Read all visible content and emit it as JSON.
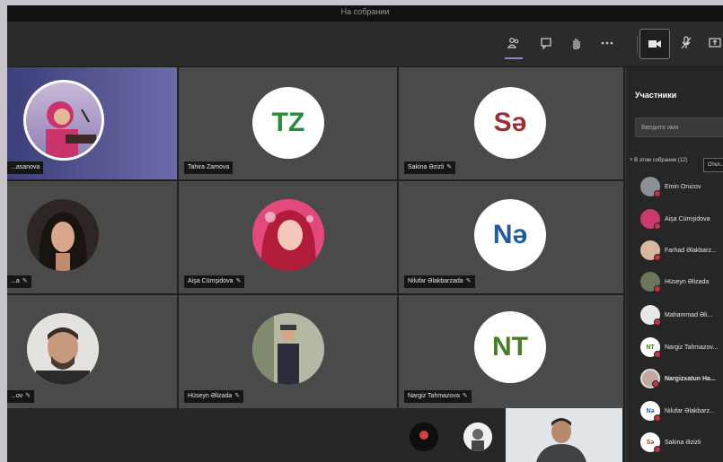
{
  "window": {
    "title": "На собрании"
  },
  "toolbar": {
    "icons": [
      "participants-icon",
      "chat-icon",
      "raise-hand-icon",
      "more-icon",
      "camera-icon",
      "mic-off-icon",
      "share-icon"
    ]
  },
  "tiles": [
    {
      "name": "...asanova",
      "mic_muted": false
    },
    {
      "name": "Tahira Zamova",
      "initials": "TZ",
      "color": "#2a8a3a",
      "mic_muted": false
    },
    {
      "name": "Sakina Əzizli",
      "initials": "Sə",
      "color": "#9b3030",
      "mic_muted": true
    },
    {
      "name": "...a",
      "mic_muted": true
    },
    {
      "name": "Aişa Cümşidova",
      "mic_muted": true
    },
    {
      "name": "Nilufar Əlakbarzada",
      "initials": "Nə",
      "color": "#1f5c9c",
      "mic_muted": true
    },
    {
      "name": "...ov",
      "mic_muted": true
    },
    {
      "name": "Hüseyn Əlizada",
      "mic_muted": true
    },
    {
      "name": "Nargiz Tahmazova",
      "initials": "NT",
      "color": "#4a7a2a",
      "mic_muted": true
    }
  ],
  "panel": {
    "title": "Участники",
    "search_placeholder": "Введите имя",
    "section_label": "В этом собрании (12)",
    "section_button": "Откл...",
    "participants": [
      {
        "name": "Emin Orucov"
      },
      {
        "name": "Aişa Cümşidova"
      },
      {
        "name": "Farhad Əlakbarz..."
      },
      {
        "name": "Hüseyn Əlizada"
      },
      {
        "name": "Mahammad Əli..."
      },
      {
        "name": "Nargiz Tahmazov...",
        "initials": "NT"
      },
      {
        "name": "Nargizxatun Ha..."
      },
      {
        "name": "Nilufar Əlakbarz...",
        "initials": "Nə"
      },
      {
        "name": "Sakina Əzizli",
        "initials": "Sə"
      }
    ]
  }
}
